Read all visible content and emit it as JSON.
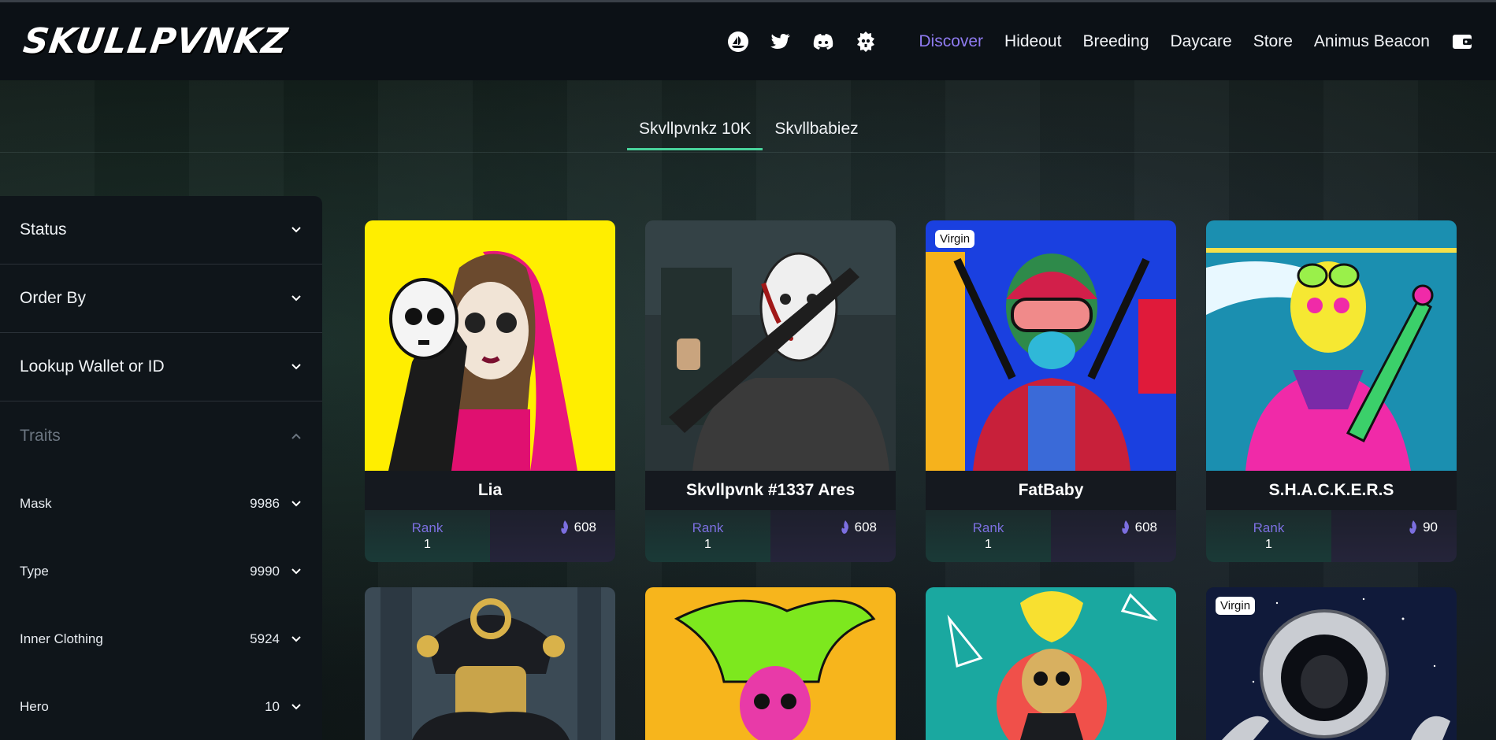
{
  "header": {
    "logo": "SKULLPVNKZ",
    "icons": [
      "opensea-icon",
      "twitter-icon",
      "discord-icon",
      "skull-gear-icon"
    ],
    "nav": [
      "Discover",
      "Hideout",
      "Breeding",
      "Daycare",
      "Store",
      "Animus Beacon"
    ],
    "active_nav": "Discover",
    "wallet_icon": "wallet-icon"
  },
  "tabs": [
    {
      "label": "Skvllpvnkz 10K",
      "active": true
    },
    {
      "label": "Skvllbabiez",
      "active": false
    }
  ],
  "sidebar": {
    "sections": [
      {
        "label": "Status"
      },
      {
        "label": "Order By"
      },
      {
        "label": "Lookup Wallet or ID"
      },
      {
        "label": "Traits"
      }
    ],
    "traits": [
      {
        "name": "Mask",
        "count": "9986"
      },
      {
        "name": "Type",
        "count": "9990"
      },
      {
        "name": "Inner Clothing",
        "count": "5924"
      },
      {
        "name": "Hero",
        "count": "10"
      }
    ]
  },
  "cards": [
    {
      "name": "Lia",
      "rank_label": "Rank",
      "rank": "1",
      "score": "608",
      "badge": ""
    },
    {
      "name": "Skvllpvnk #1337 Ares",
      "rank_label": "Rank",
      "rank": "1",
      "score": "608",
      "badge": ""
    },
    {
      "name": "FatBaby",
      "rank_label": "Rank",
      "rank": "1",
      "score": "608",
      "badge": "Virgin"
    },
    {
      "name": "S.H.A.C.K.E.R.S",
      "rank_label": "Rank",
      "rank": "1",
      "score": "90",
      "badge": ""
    },
    {
      "name": "",
      "badge": ""
    },
    {
      "name": "",
      "badge": ""
    },
    {
      "name": "",
      "badge": ""
    },
    {
      "name": "",
      "badge": "Virgin"
    }
  ],
  "colors": {
    "accent_purple": "#8f7bf0",
    "tab_underline": "#49d39b",
    "card_yellow": "#ffee00",
    "card_blue": "#1a40e0",
    "card_teal": "#1b8fb0"
  }
}
